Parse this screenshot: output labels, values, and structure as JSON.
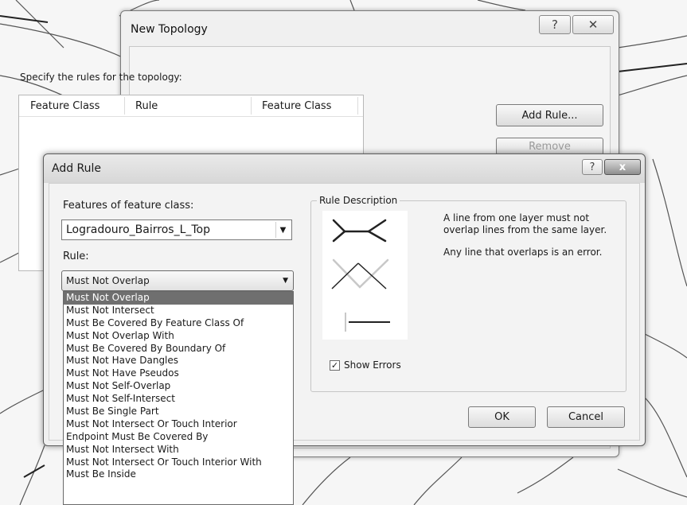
{
  "topology_window": {
    "title": "New Topology",
    "help_icon": "?",
    "close_icon": "✕",
    "instruction": "Specify the rules for the topology:",
    "columns": [
      "Feature Class",
      "Rule",
      "Feature Class"
    ],
    "add_rule_button": "Add Rule...",
    "remove_button": "Remove"
  },
  "add_rule_dialog": {
    "title": "Add Rule",
    "help_icon": "?",
    "close_icon": "x",
    "features_label": "Features of feature class:",
    "feature_class_value": "Logradouro_Bairros_L_Top",
    "rule_label": "Rule:",
    "rule_value": "Must Not Overlap",
    "rule_options": [
      "Must Not Overlap",
      "Must Not Intersect",
      "Must Be Covered By Feature Class Of",
      "Must Not Overlap With",
      "Must Be Covered By Boundary Of",
      "Must Not Have Dangles",
      "Must Not Have Pseudos",
      "Must Not Self-Overlap",
      "Must Not Self-Intersect",
      "Must Be Single Part",
      "Must Not Intersect Or Touch Interior",
      "Endpoint Must Be Covered By",
      "Must Not Intersect With",
      "Must Not Intersect Or Touch Interior With",
      "Must Be Inside"
    ],
    "rule_description_title": "Rule Description",
    "description_line1": "A line from one layer must not overlap lines from the same layer.",
    "description_line2": "Any line that overlaps is an error.",
    "show_errors_label": "Show Errors",
    "show_errors_checked": true,
    "ok_button": "OK",
    "cancel_button": "Cancel"
  }
}
